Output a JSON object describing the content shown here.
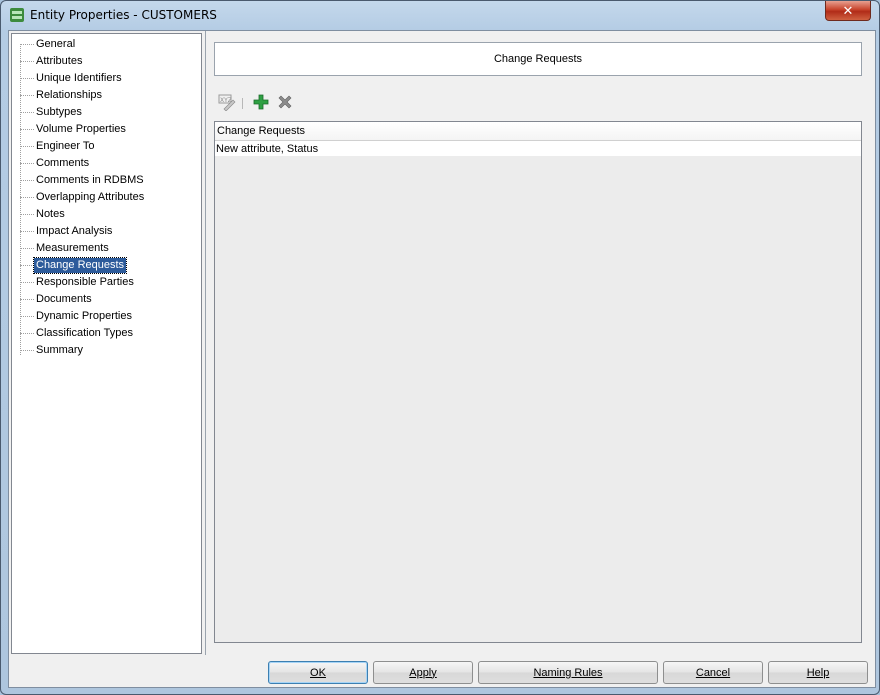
{
  "window": {
    "title": "Entity Properties - CUSTOMERS",
    "close_glyph": "✕"
  },
  "nav": {
    "items": [
      {
        "label": "General",
        "selected": false
      },
      {
        "label": "Attributes",
        "selected": false
      },
      {
        "label": "Unique Identifiers",
        "selected": false
      },
      {
        "label": "Relationships",
        "selected": false
      },
      {
        "label": "Subtypes",
        "selected": false
      },
      {
        "label": "Volume Properties",
        "selected": false
      },
      {
        "label": "Engineer To",
        "selected": false
      },
      {
        "label": "Comments",
        "selected": false
      },
      {
        "label": "Comments in RDBMS",
        "selected": false
      },
      {
        "label": "Overlapping Attributes",
        "selected": false
      },
      {
        "label": "Notes",
        "selected": false
      },
      {
        "label": "Impact Analysis",
        "selected": false
      },
      {
        "label": "Measurements",
        "selected": false
      },
      {
        "label": "Change Requests",
        "selected": true
      },
      {
        "label": "Responsible Parties",
        "selected": false
      },
      {
        "label": "Documents",
        "selected": false
      },
      {
        "label": "Dynamic Properties",
        "selected": false
      },
      {
        "label": "Classification Types",
        "selected": false
      },
      {
        "label": "Summary",
        "selected": false
      }
    ]
  },
  "panel": {
    "section_title": "Change Requests",
    "toolbar": {
      "icons": [
        "edit-xyz-icon",
        "add-plus-icon",
        "delete-x-icon"
      ]
    },
    "grid": {
      "column_header": "Change Requests",
      "rows": [
        "New attribute, Status"
      ]
    }
  },
  "buttons": {
    "ok": "OK",
    "apply": "Apply",
    "naming_rules": "Naming Rules",
    "cancel": "Cancel",
    "help": "Help"
  },
  "colors": {
    "selection": "#2d5b9b",
    "add_icon": "#2ea043",
    "close_button": "#c8442c"
  }
}
